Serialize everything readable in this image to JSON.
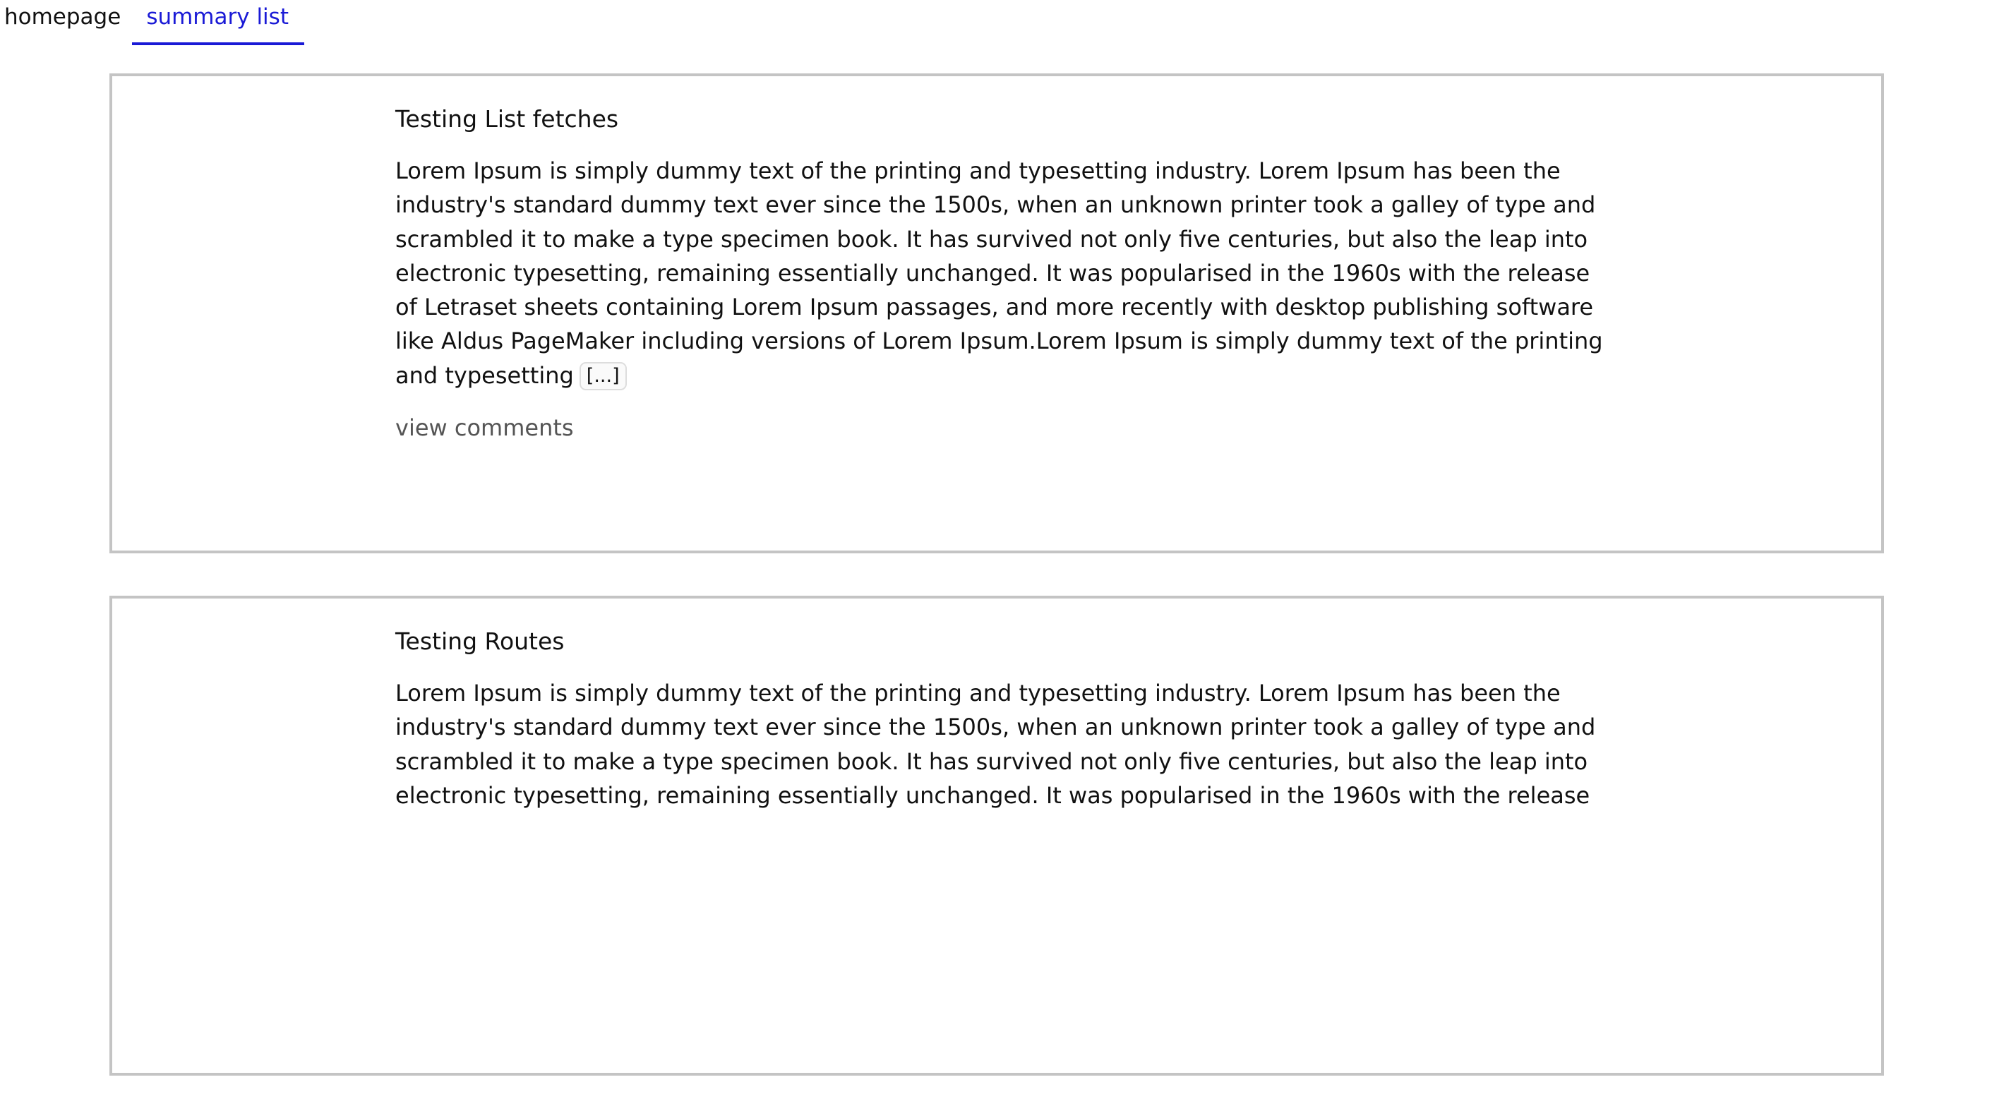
{
  "nav": {
    "items": [
      {
        "label": "homepage",
        "active": false
      },
      {
        "label": "summary list",
        "active": true
      }
    ],
    "active_color": "#1a1ad6"
  },
  "posts": [
    {
      "title": "Testing List fetches",
      "body": "Lorem Ipsum is simply dummy text of the printing and typesetting industry. Lorem Ipsum has been the industry's standard dummy text ever since the 1500s, when an unknown printer took a galley of type and scrambled it to make a type specimen book. It has survived not only five centuries, but also the leap into electronic typesetting, remaining essentially unchanged. It was popularised in the 1960s with the release of Letraset sheets containing Lorem Ipsum passages, and more recently with desktop publishing software like Aldus PageMaker including versions of Lorem Ipsum.Lorem Ipsum is simply dummy text of the printing and typesetting",
      "more_label": "[...]",
      "comments_label": "view comments"
    },
    {
      "title": "Testing Routes",
      "body": "Lorem Ipsum is simply dummy text of the printing and typesetting industry. Lorem Ipsum has been the industry's standard dummy text ever since the 1500s, when an unknown printer took a galley of type and scrambled it to make a type specimen book. It has survived not only five centuries, but also the leap into electronic typesetting, remaining essentially unchanged. It was popularised in the 1960s with the release",
      "more_label": "",
      "comments_label": ""
    }
  ]
}
